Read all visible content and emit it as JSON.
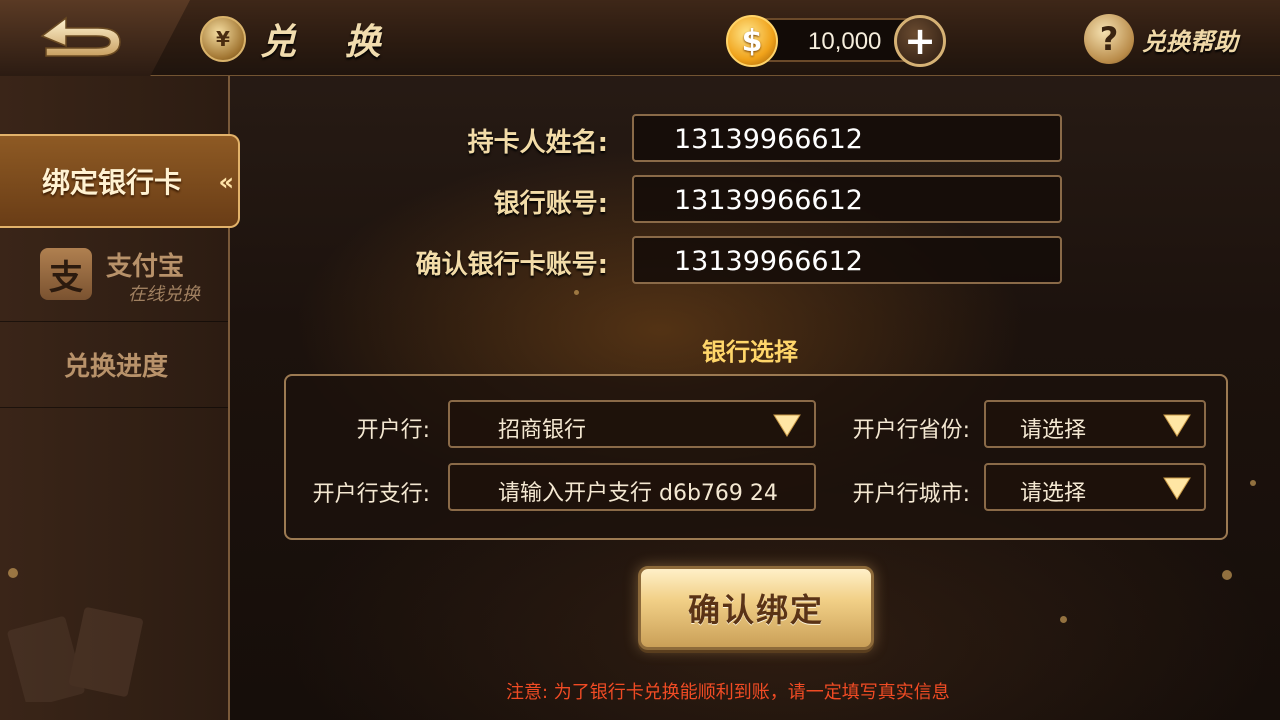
{
  "header": {
    "title": "兑 换",
    "title_icon": "yen-coin-icon",
    "back_icon": "back-arrow-icon",
    "balance": "10,000",
    "help_label": "兑换帮助"
  },
  "sidebar": {
    "items": [
      {
        "label": "绑定银行卡",
        "active": true
      },
      {
        "label": "支付宝",
        "sub": "在线兑换",
        "icon": "alipay-icon",
        "logo_text": "支"
      },
      {
        "label": "兑换进度"
      }
    ]
  },
  "form": {
    "holder_label": "持卡人姓名:",
    "holder_value": "13139966612",
    "account_label": "银行账号:",
    "account_value": "13139966612",
    "confirm_account_label": "确认银行卡账号:",
    "confirm_account_value": "13139966612"
  },
  "bank": {
    "section_title": "银行选择",
    "bank_label": "开户行:",
    "bank_value": "招商银行",
    "province_label": "开户行省份:",
    "province_value": "请选择",
    "branch_label": "开户行支行:",
    "branch_value": "请输入开户支行 d6b769 24",
    "city_label": "开户行城市:",
    "city_value": "请选择"
  },
  "actions": {
    "confirm_label": "确认绑定"
  },
  "notice": "注意: 为了银行卡兑换能顺利到账，请一定填写真实信息",
  "colors": {
    "accent_gold": "#f3dca8",
    "section_yellow": "#ffd66a",
    "notice_red": "#f04b24",
    "panel_border": "#9c7a52"
  }
}
